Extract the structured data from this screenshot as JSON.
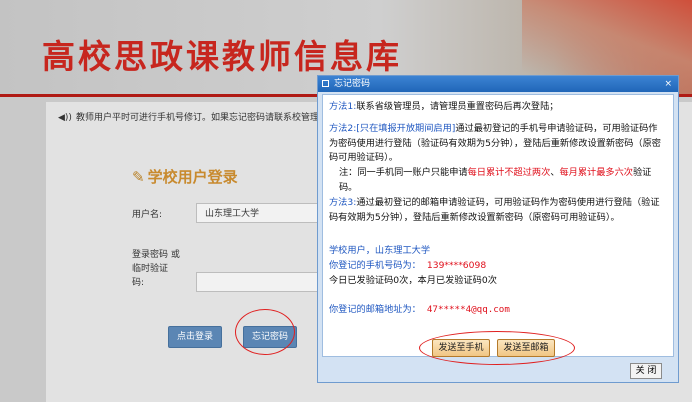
{
  "header": {
    "title": "高校思政课教师信息库"
  },
  "notice": {
    "text": "教师用户平时可进行手机号修订。如果忘记密码请联系校管理"
  },
  "login": {
    "title": "学校用户登录",
    "username_label": "用户名:",
    "username_value": "山东理工大学",
    "password_label_line1": "登录密码  或",
    "password_label_line2": "临时验证",
    "password_label_line3": "码:",
    "login_button": "点击登录",
    "forgot_button": "忘记密码"
  },
  "dialog": {
    "title": "忘记密码",
    "method1_head": "方法1:",
    "method1_text": "联系省级管理员，请管理员重置密码后再次登陆；",
    "method2_head": "方法2:",
    "method2_bracket": "[只在填报开放期间启用]",
    "method2_text": "通过最初登记的手机号申请验证码，可用验证码作为密码使用进行登陆（验证码有效期为5分钟），登陆后重新修改设置新密码（原密码可用验证码）。",
    "note_prefix": "注：同一手机同一账户只能申请",
    "note_red1": "每日累计不超过两次",
    "note_sep": "、",
    "note_red2": "每月累计最多六次",
    "note_suffix": "验证码。",
    "method3_head": "方法3:",
    "method3_text": "通过最初登记的邮箱申请验证码，可用验证码作为密码使用进行登陆（验证码有效期为5分钟），登陆后重新修改设置新密码（原密码可用验证码）。",
    "school_line": "学校用户，山东理工大学",
    "phone_label": "你登记的手机号码为：",
    "phone_value": "139****6098",
    "sent_count": "今日已发验证码0次，本月已发验证码0次",
    "email_label": "你登记的邮箱地址为：",
    "email_value": "47*****4@qq.com",
    "send_phone_button": "发送至手机",
    "send_email_button": "发送至邮箱",
    "close_button": "关 闭",
    "close_x": "×"
  },
  "colors": {
    "brand_red": "#c7261e",
    "dialog_blue": "#2066b8",
    "link_blue": "#1f57c0",
    "alert_red": "#e0101c"
  }
}
